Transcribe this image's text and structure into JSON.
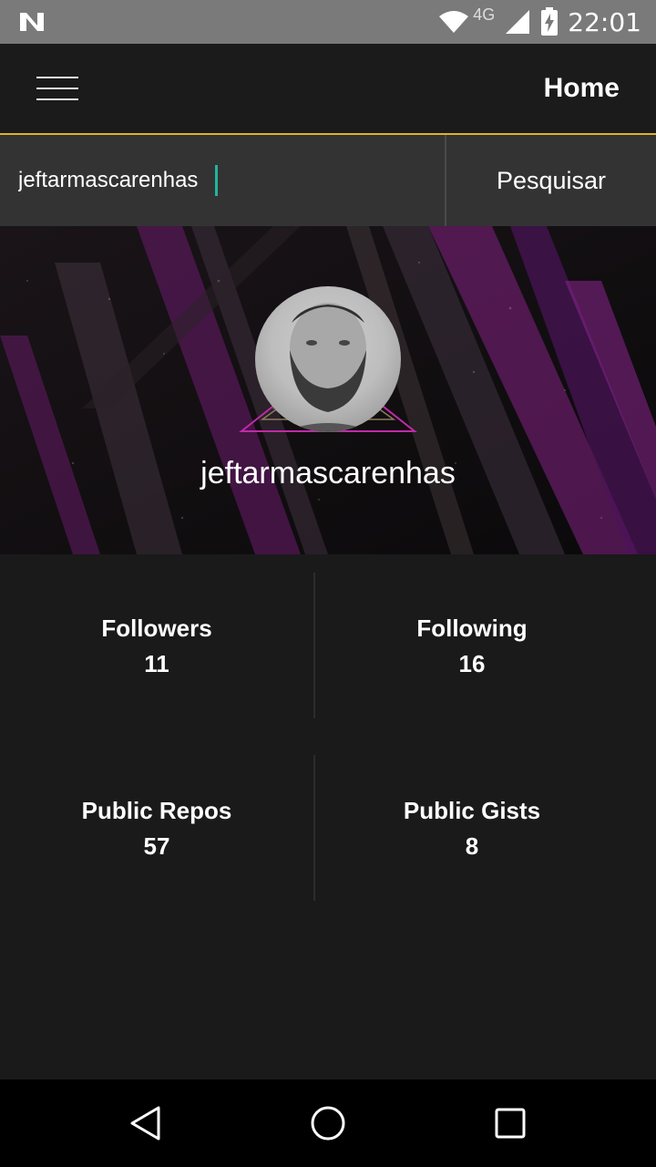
{
  "status_bar": {
    "network": "4G",
    "time": "22:01",
    "icons": [
      "n-logo-icon",
      "wifi-icon",
      "signal-icon",
      "battery-charging-icon"
    ]
  },
  "app_bar": {
    "title": "Home",
    "menu_icon": "hamburger-menu-icon"
  },
  "search": {
    "value": "jeftarmascarenhas",
    "button_label": "Pesquisar"
  },
  "profile": {
    "username": "jeftarmascarenhas"
  },
  "stats": [
    {
      "label": "Followers",
      "value": "11"
    },
    {
      "label": "Following",
      "value": "16"
    },
    {
      "label": "Public Repos",
      "value": "57"
    },
    {
      "label": "Public Gists",
      "value": "8"
    }
  ],
  "nav_bar": {
    "icons": [
      "back-icon",
      "home-icon",
      "recents-icon"
    ]
  },
  "colors": {
    "accent": "#e0b12e",
    "cursor": "#1fb5a0",
    "background": "#1a1a1a",
    "banner_purple": "#7a1f7a"
  }
}
